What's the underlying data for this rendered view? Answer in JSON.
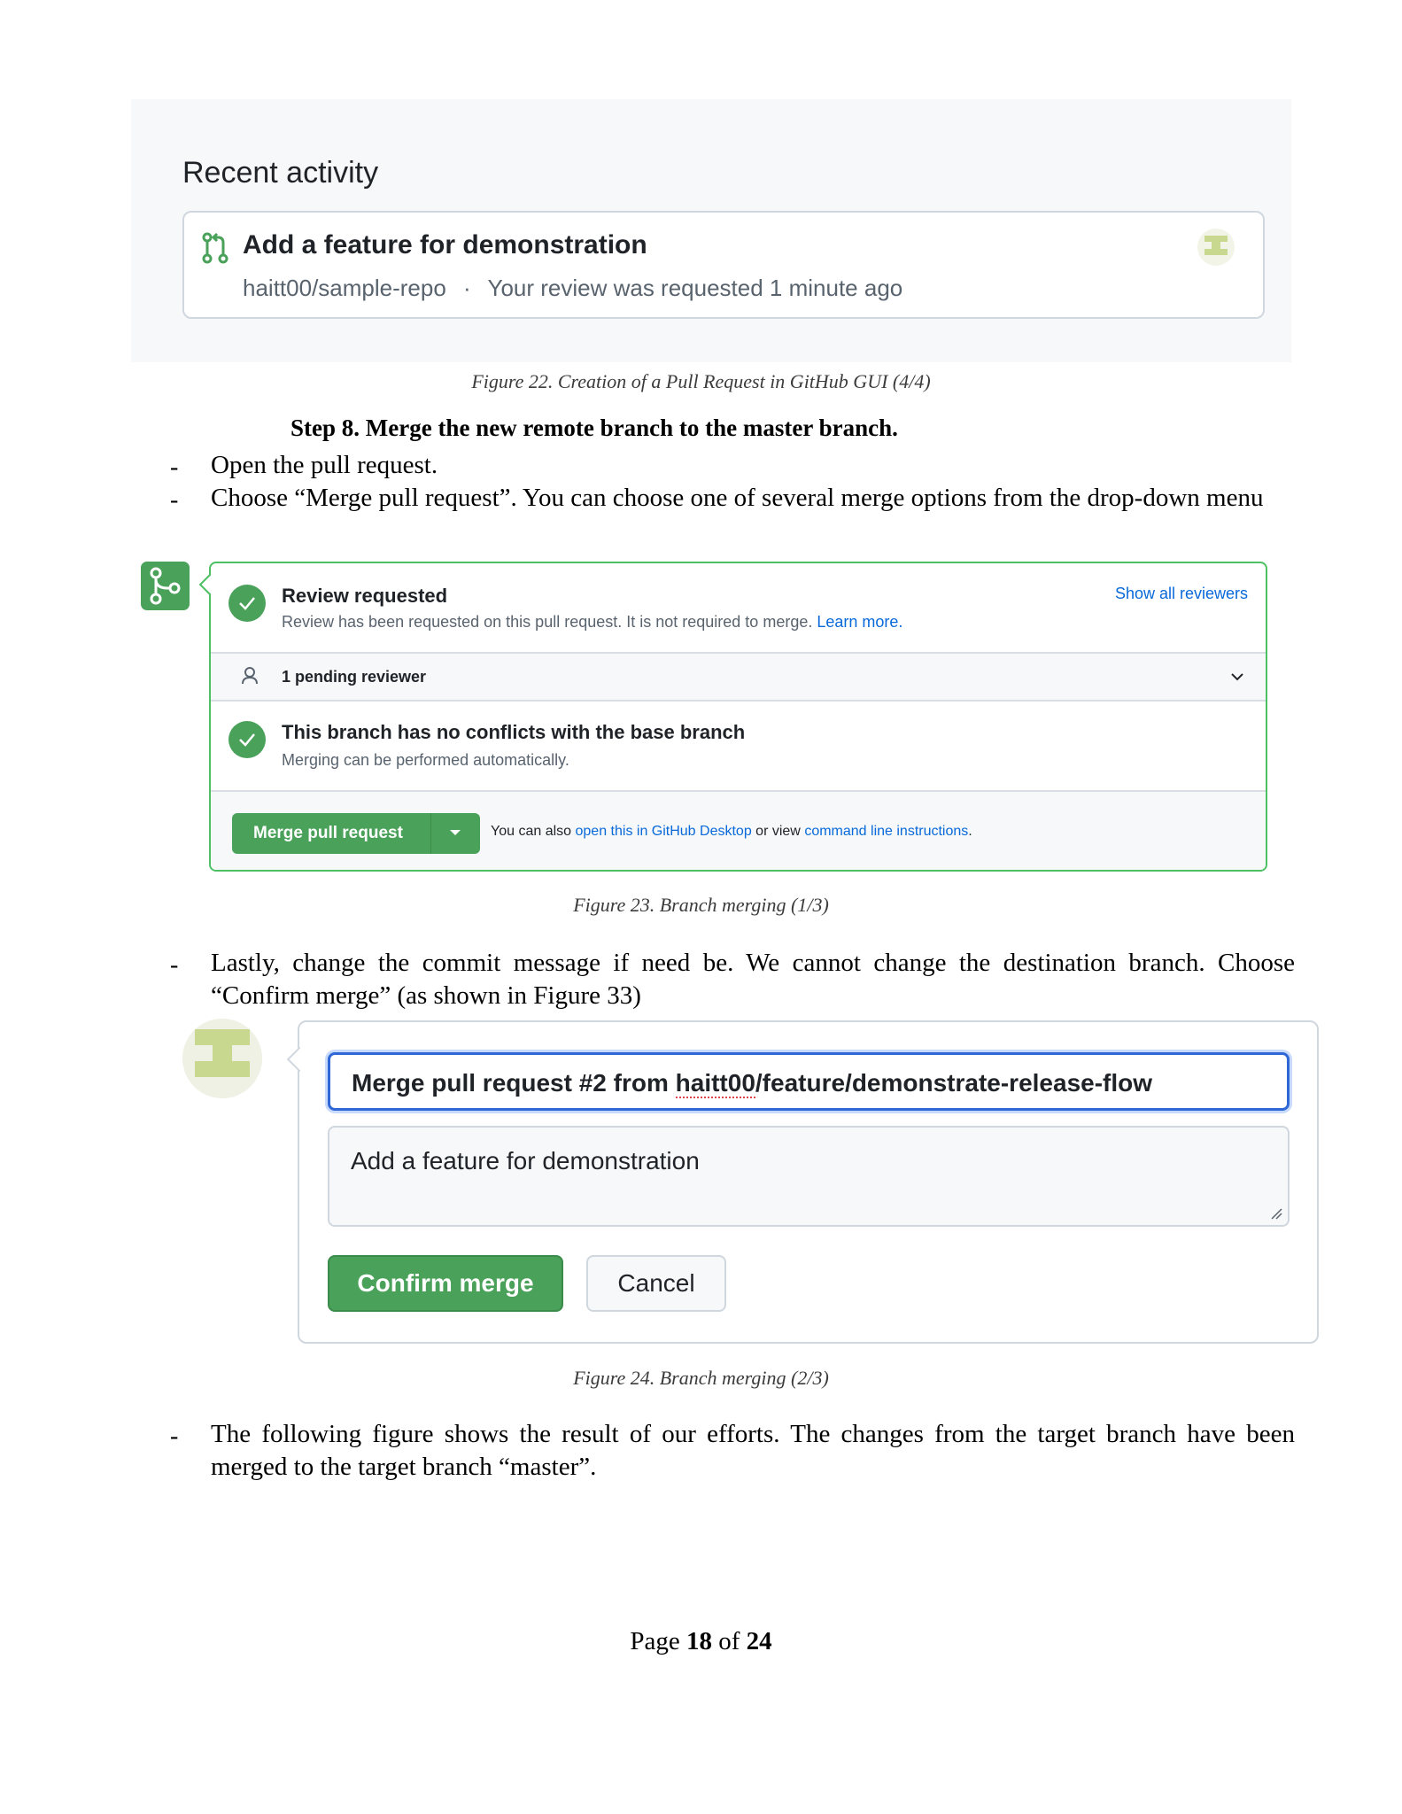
{
  "figure22": {
    "heading": "Recent activity",
    "item_title": "Add a feature for demonstration",
    "repo": "haitt00/sample-repo",
    "separator": "·",
    "status": "Your review was requested 1 minute ago",
    "caption": "Figure 22. Creation of a Pull Request in GitHub GUI (4/4)"
  },
  "step8": {
    "heading": "Step 8. Merge the new remote branch to the master branch.",
    "bullets": [
      "Open the pull request.",
      "Choose “Merge pull request”. You can choose one of several merge options from the drop-down menu"
    ],
    "dash": "-"
  },
  "figure23": {
    "review_title": "Review requested",
    "review_text": "Review has been requested on this pull request. It is not required to merge.",
    "learn_more": "Learn more.",
    "show_reviewers": "Show all reviewers",
    "pending": "1 pending reviewer",
    "conflict_title": "This branch has no conflicts with the base branch",
    "conflict_text": "Merging can be performed automatically.",
    "merge_button": "Merge pull request",
    "note_prefix": "You can also",
    "note_link1": "open this in GitHub Desktop",
    "note_middle": "or view",
    "note_link2": "command line instructions",
    "note_end": ".",
    "caption": "Figure 23. Branch merging (1/3)"
  },
  "bullet3": "Lastly, change the commit message if need be. We cannot change the destination branch. Choose “Confirm merge” (as shown in Figure 33)",
  "figure24": {
    "title_prefix": "Merge pull request #2 from ",
    "title_user": "haitt00",
    "title_suffix": "/feature/demonstrate-release-flow",
    "body": "Add a feature for demonstration",
    "confirm": "Confirm merge",
    "cancel": "Cancel",
    "caption": "Figure 24. Branch merging (2/3)"
  },
  "bullet4": "The following figure shows the result of our efforts. The changes from the target branch have been merged to the target branch “master”.",
  "footer": {
    "page_word": "Page",
    "page": "18",
    "of_word": "of",
    "total": "24"
  },
  "colors": {
    "github_green": "#4aa15a",
    "link_blue": "#0969da",
    "focus_blue": "#2f68d6"
  }
}
